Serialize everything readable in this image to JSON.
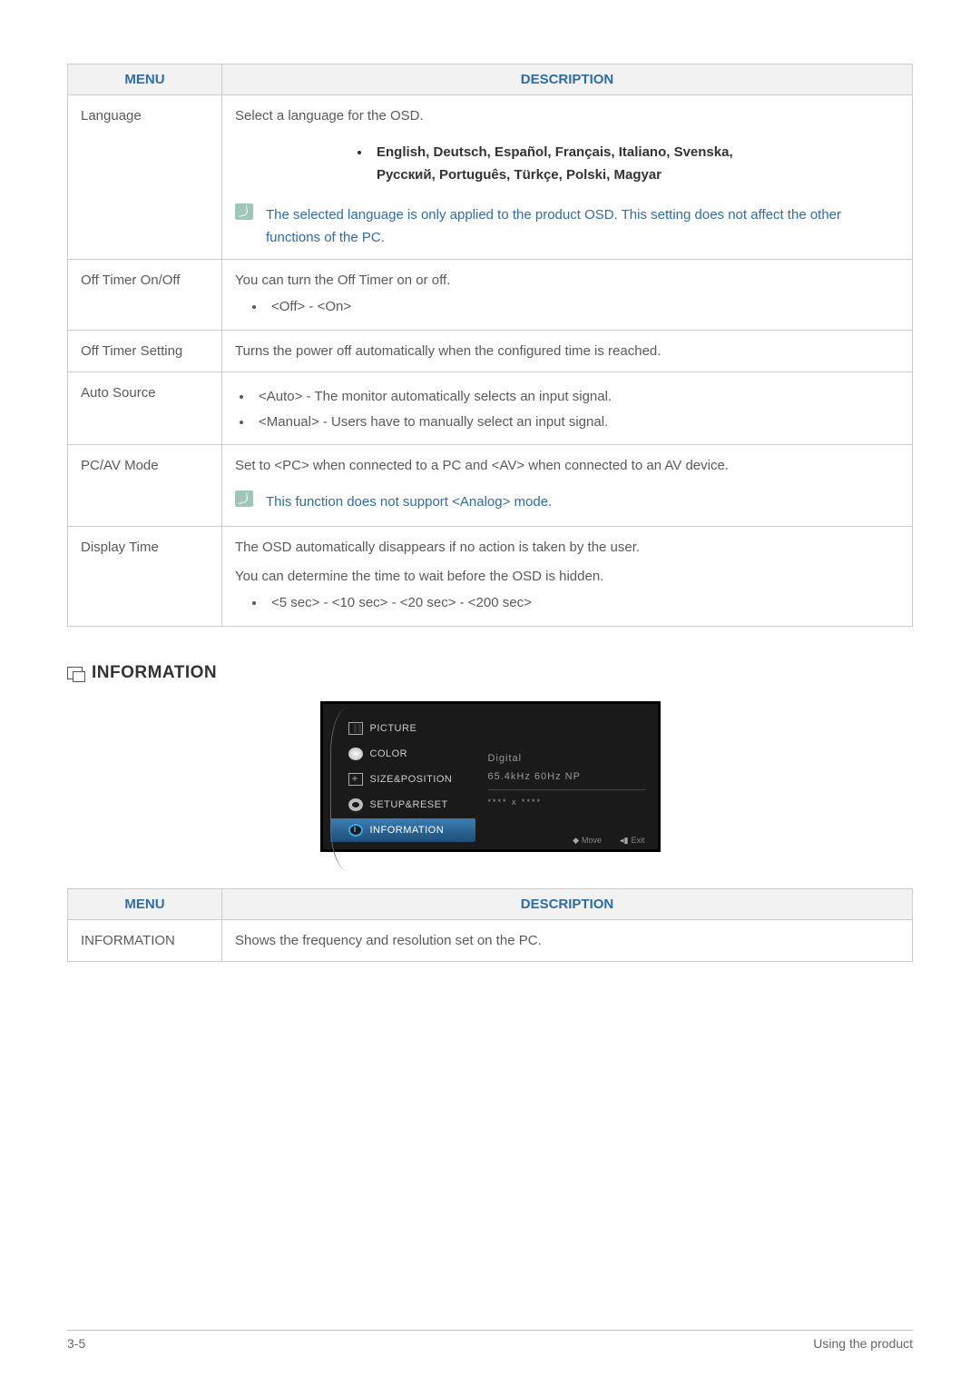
{
  "table1": {
    "headers": {
      "menu": "MENU",
      "desc": "DESCRIPTION"
    },
    "rows": {
      "language": {
        "name": "Language",
        "intro": "Select a language for the OSD.",
        "langs_line1": "English, Deutsch, Español, Français, Italiano, Svenska,",
        "langs_line2": "Русский, Português, Türkçe, Polski, Magyar",
        "note": "The selected language is only applied to the product OSD. This setting does not affect the other functions of the PC."
      },
      "offtimer_onoff": {
        "name": "Off Timer On/Off",
        "intro": "You can turn the Off Timer on or off.",
        "bullet1": "<Off> - <On>"
      },
      "offtimer_setting": {
        "name": "Off Timer Setting",
        "intro": "Turns the power off automatically when the configured time is reached."
      },
      "autosource": {
        "name": "Auto Source",
        "bullet1": "<Auto> - The monitor automatically selects an input signal.",
        "bullet2": "<Manual> - Users have to manually select an input signal."
      },
      "pcav": {
        "name": "PC/AV Mode",
        "intro": "Set to <PC> when connected to a PC and <AV> when connected to an AV device.",
        "note": "This function does not support <Analog> mode."
      },
      "displaytime": {
        "name": "Display Time",
        "line1": "The OSD automatically disappears if no action is taken by the user.",
        "line2": "You can determine the time to wait before the OSD is hidden.",
        "bullet1": "<5 sec> - <10 sec> - <20 sec> - <200 sec>"
      }
    }
  },
  "section": {
    "title": "INFORMATION"
  },
  "osd": {
    "items": {
      "picture": "PICTURE",
      "color": "COLOR",
      "sizepos": "SIZE&POSITION",
      "setup": "SETUP&RESET",
      "info": "INFORMATION"
    },
    "right": {
      "line1": "Digital",
      "line2": "65.4kHz 60Hz NP",
      "line3": "**** x ****"
    },
    "footer": {
      "move": "Move",
      "exit": "Exit"
    }
  },
  "table2": {
    "headers": {
      "menu": "MENU",
      "desc": "DESCRIPTION"
    },
    "row": {
      "name": "INFORMATION",
      "desc": "Shows the frequency and resolution set on the PC."
    }
  },
  "footer": {
    "page": "3-5",
    "chapter": "Using the product"
  }
}
